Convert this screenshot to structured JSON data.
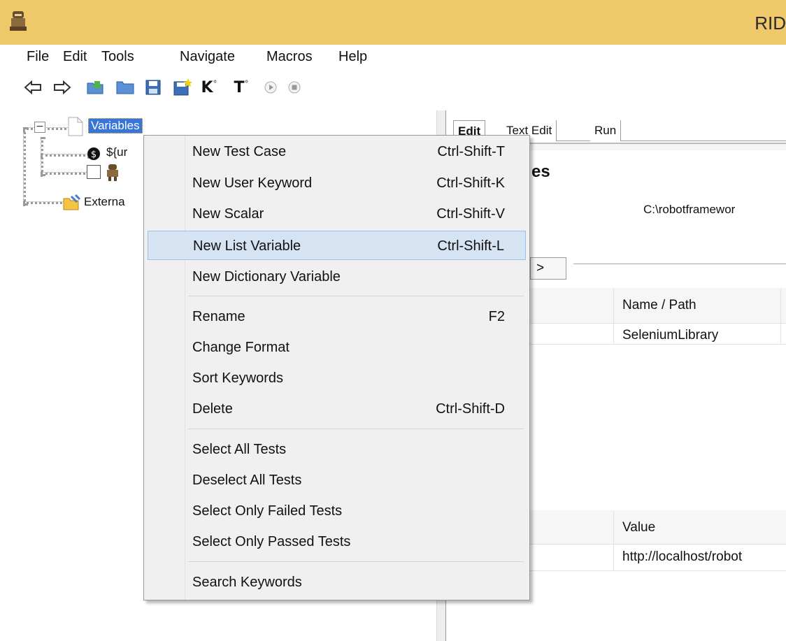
{
  "window": {
    "title": "RID"
  },
  "menubar": [
    "File",
    "Edit",
    "Tools",
    "Navigate",
    "Macros",
    "Help"
  ],
  "toolbar": {
    "icons": [
      "back-arrow-icon",
      "forward-arrow-icon",
      "open-folder-icon",
      "folder-icon",
      "save-icon",
      "save-all-icon",
      "search-keyword-icon",
      "search-test-icon",
      "run-icon",
      "stop-icon"
    ],
    "glyphs": [
      "⇦",
      "⇨",
      "📂",
      "📁",
      "💾",
      "🗄",
      "K",
      "T",
      "▶",
      "■"
    ]
  },
  "tree": {
    "root": "Variables",
    "child1": "${ur",
    "child2_partial": " ",
    "external": "Externa"
  },
  "editor": {
    "tabs": [
      "Edit",
      "Text Edit",
      "Run"
    ],
    "heading_partial": "es",
    "path_partial": "C:\\robotframewor",
    "arrow_btn": ">",
    "imports_header": "Name / Path",
    "imports_row": "SeleniumLibrary",
    "vars_header": "Value",
    "vars_row": "http://localhost/robot"
  },
  "context_menu": {
    "items": [
      {
        "label": "New Test Case",
        "shortcut": "Ctrl-Shift-T"
      },
      {
        "label": "New User Keyword",
        "shortcut": "Ctrl-Shift-K"
      },
      {
        "label": "New Scalar",
        "shortcut": "Ctrl-Shift-V"
      },
      {
        "label": "New List Variable",
        "shortcut": "Ctrl-Shift-L",
        "highlighted": true
      },
      {
        "label": "New Dictionary Variable",
        "shortcut": ""
      },
      {
        "label": "Rename",
        "shortcut": "F2"
      },
      {
        "label": "Change Format",
        "shortcut": ""
      },
      {
        "label": "Sort Keywords",
        "shortcut": ""
      },
      {
        "label": "Delete",
        "shortcut": "Ctrl-Shift-D"
      },
      {
        "label": "Select All Tests",
        "shortcut": ""
      },
      {
        "label": "Deselect All Tests",
        "shortcut": ""
      },
      {
        "label": "Select Only Failed Tests",
        "shortcut": ""
      },
      {
        "label": "Select Only Passed Tests",
        "shortcut": ""
      },
      {
        "label": "Search Keywords",
        "shortcut": ""
      }
    ]
  },
  "colors": {
    "titlebar": "#efc86a",
    "selection": "#3875d7",
    "menu_highlight": "#d5e3f3"
  }
}
